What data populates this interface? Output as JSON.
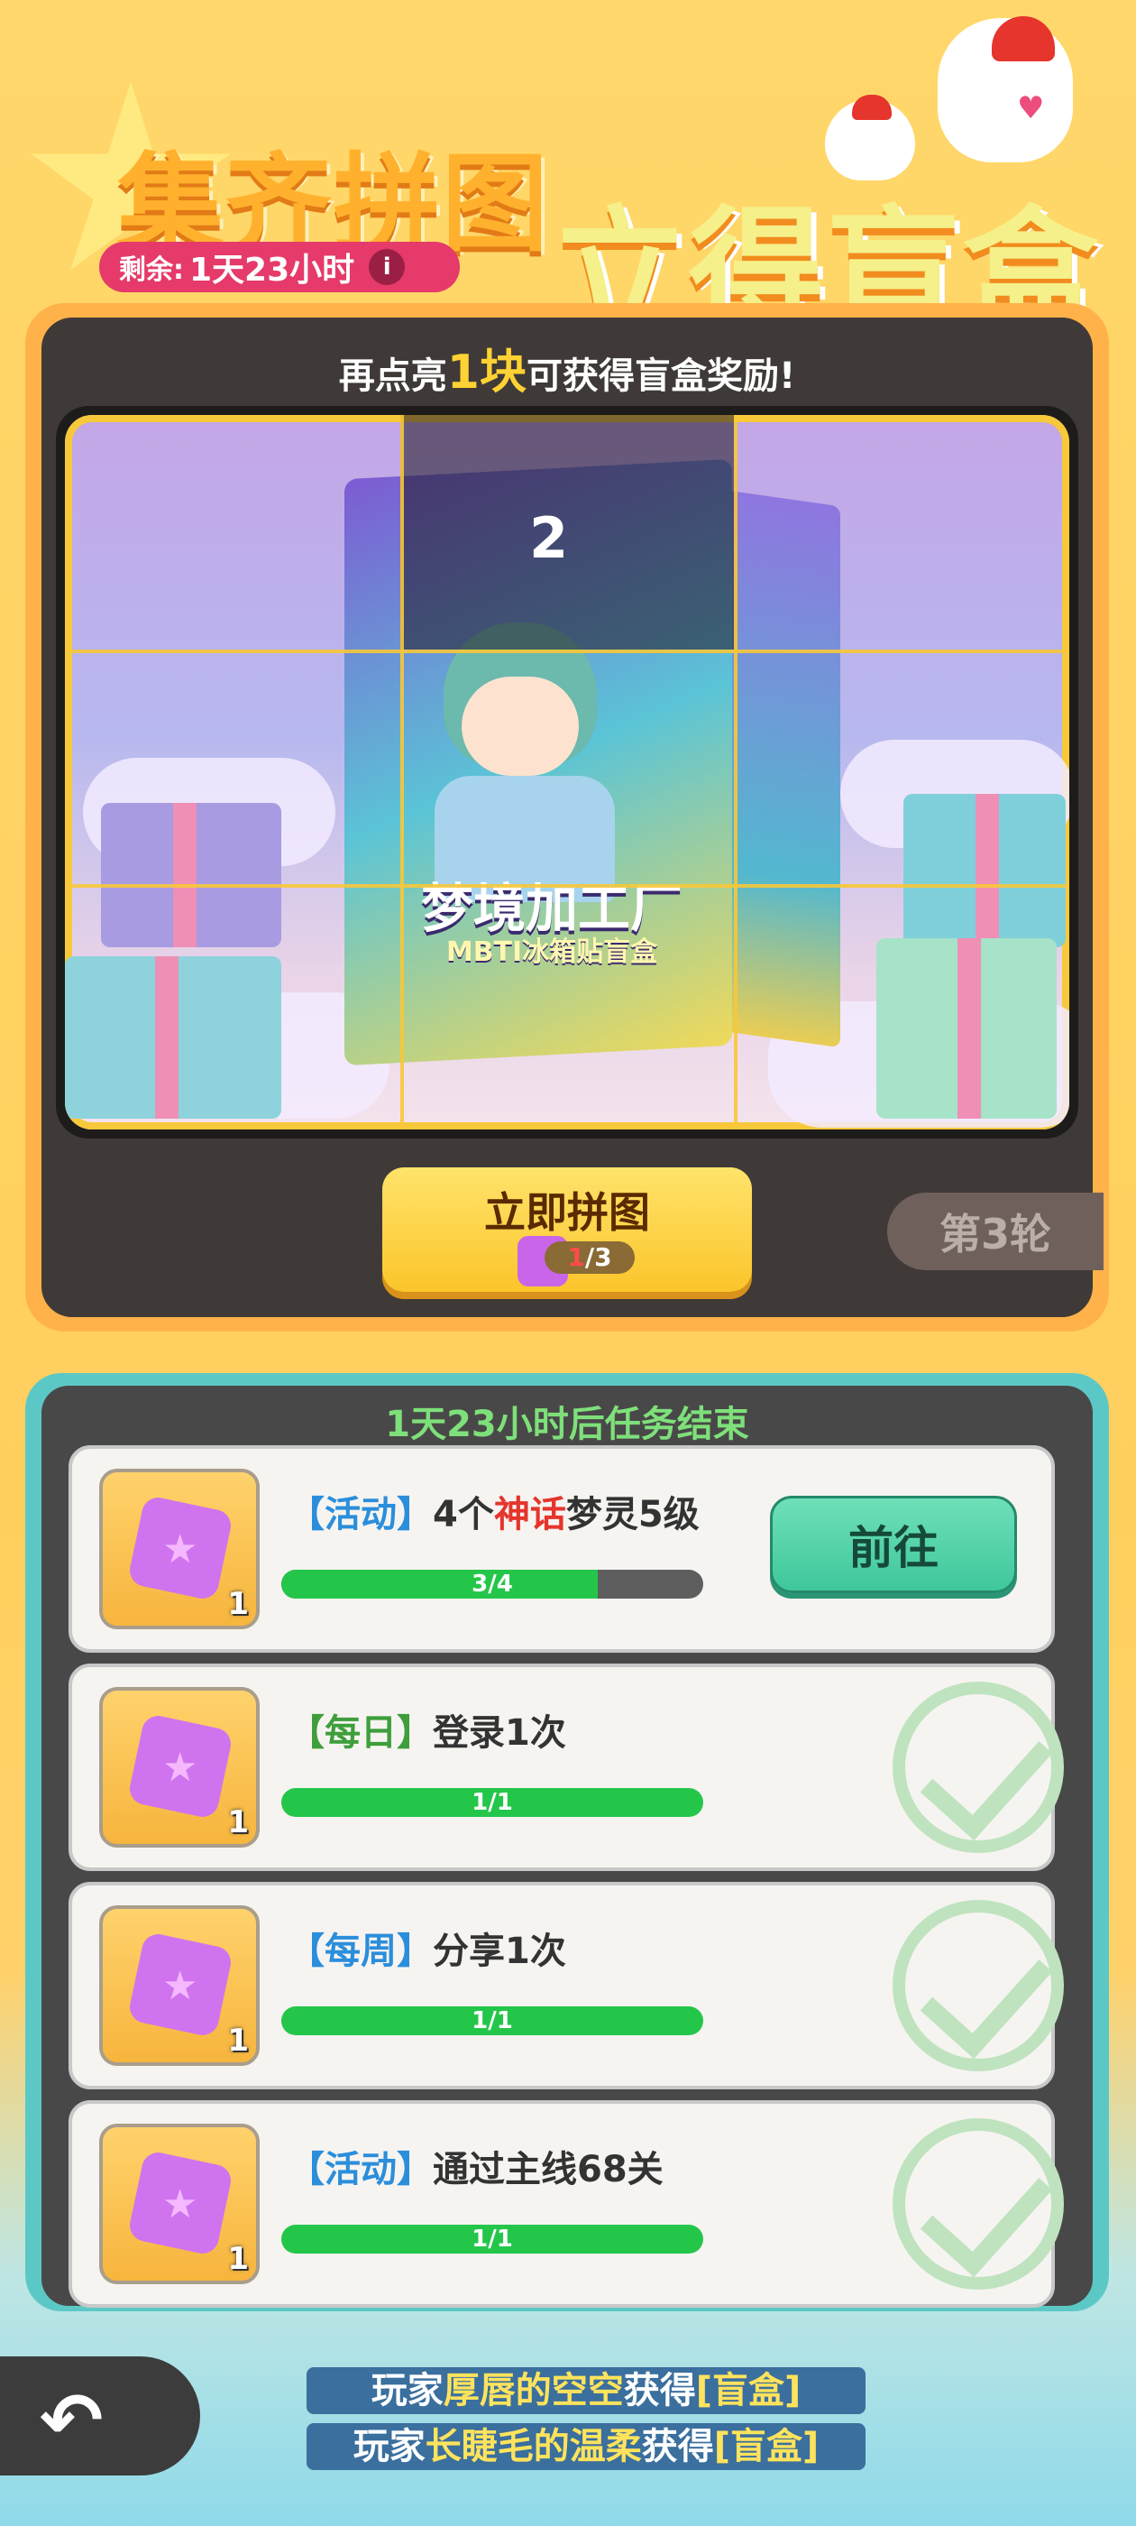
{
  "header": {
    "title_left": "集齐拼图",
    "title_right": "立得盲盒",
    "timer_label": "剩余:",
    "timer_value": "1天23小时",
    "info_symbol": "i"
  },
  "puzzle": {
    "hint_prefix": "再点亮",
    "hint_highlight": "1块",
    "hint_suffix": "可获得盲盒奖励!",
    "locked_piece_number": "2",
    "box_title": "梦境加工厂",
    "box_subtitle": "MBTI冰箱贴盲盒",
    "assemble_button_label": "立即拼图",
    "pieces_have": "1",
    "pieces_total": "/3",
    "round_label": "第3轮"
  },
  "tasks": {
    "header": "1天23小时后任务结束",
    "items": [
      {
        "tag": "【活动】",
        "tag_color": "blue",
        "text_a": "4个",
        "text_hl": "神话",
        "text_b": "梦灵5级",
        "reward_qty": "1",
        "progress_text": "3/4",
        "progress": 0.75,
        "action_label": "前往",
        "done": false
      },
      {
        "tag": "【每日】",
        "tag_color": "green",
        "text_a": "登录1次",
        "text_hl": "",
        "text_b": "",
        "reward_qty": "1",
        "progress_text": "1/1",
        "progress": 1.0,
        "done": true
      },
      {
        "tag": "【每周】",
        "tag_color": "blue",
        "text_a": "分享1次",
        "text_hl": "",
        "text_b": "",
        "reward_qty": "1",
        "progress_text": "1/1",
        "progress": 1.0,
        "done": true
      },
      {
        "tag": "【活动】",
        "tag_color": "blue",
        "text_a": "通过主线68关",
        "text_hl": "",
        "text_b": "",
        "reward_qty": "1",
        "progress_text": "1/1",
        "progress": 1.0,
        "done": true
      }
    ]
  },
  "ticker": [
    {
      "prefix": "玩家",
      "name": "厚唇的空空",
      "mid": "获得",
      "prize": "[盲盒]"
    },
    {
      "prefix": "玩家",
      "name": "长睫毛的温柔",
      "mid": "获得",
      "prize": "[盲盒]"
    }
  ],
  "colors": {
    "accent": "#ffb24a",
    "progress_fill": "#24c64a",
    "go_button": "#3fc79b",
    "timer_pill": "#e53a6a"
  }
}
